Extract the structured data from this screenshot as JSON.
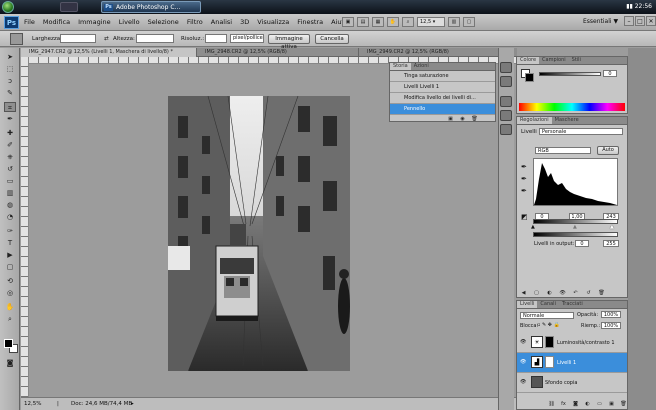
{
  "taskbar": {
    "window_title": "Adobe Photoshop C...",
    "clock": "22:56",
    "ps_badge": "Ps"
  },
  "menubar": {
    "logo": "Ps",
    "items": [
      "File",
      "Modifica",
      "Immagine",
      "Livello",
      "Selezione",
      "Filtro",
      "Analisi",
      "3D",
      "Visualizza",
      "Finestra",
      "Aiuto"
    ],
    "zoom": "12,5",
    "workspace": "Essentiali",
    "workspace_arrow": "▼"
  },
  "options": {
    "width_label": "Larghezza:",
    "height_label": "Altezza:",
    "resolution_label": "Risoluz.:",
    "unit_value": "pixel/pollice",
    "front_image_button": "Immagine attiva",
    "clear_button": "Cancella"
  },
  "document": {
    "active_tab": "IMG_2947.CR2 @ 12,5% (Livelli 1, Maschera di livello/8)",
    "tabs": [
      "IMG_2947.CR2 @ 12,5% (Livelli 1, Maschera di livello/8) *",
      "IMG_2948.CR2 @ 12,5% (RGB/8)",
      "IMG_2949.CR2 @ 12,5% (RGB/8)"
    ],
    "zoom_status": "12,5%",
    "doc_status": "Doc: 24,6 MB/74,4 MB"
  },
  "history": {
    "tabs": [
      "Storia",
      "Azioni"
    ],
    "items": [
      "Tinga saturazione",
      "Livelli Livelli 1",
      "Modifica livello dei livelli di...",
      "Pennello"
    ],
    "selected_index": 3
  },
  "color_panel": {
    "tabs": [
      "Colore",
      "Campioni",
      "Stili"
    ],
    "value": "0"
  },
  "adjustments": {
    "tabs": [
      "Regolazioni",
      "Maschere"
    ],
    "title": "Livelli",
    "preset_value": "Personale",
    "channel": "RGB",
    "auto_button": "Auto",
    "input_shadow": "0",
    "input_mid": "1,00",
    "input_high": "243",
    "output_label": "Livelli in output:",
    "output_low": "0",
    "output_high": "255"
  },
  "layers": {
    "tabs": [
      "Livelli",
      "Canali",
      "Tracciati"
    ],
    "blend_mode": "Normale",
    "opacity_label": "Opacità:",
    "opacity_value": "100%",
    "lock_label": "Blocca:",
    "fill_label": "Riemp.:",
    "fill_value": "100%",
    "rows": [
      {
        "name": "Luminosità/contrasto 1",
        "selected": false
      },
      {
        "name": "Livelli 1",
        "selected": true
      },
      {
        "name": "Sfondo copia",
        "selected": false
      }
    ]
  },
  "colors": {
    "accent": "#3b8edb",
    "menubar": "#b9b9b9",
    "canvas": "#9c9c9c"
  }
}
